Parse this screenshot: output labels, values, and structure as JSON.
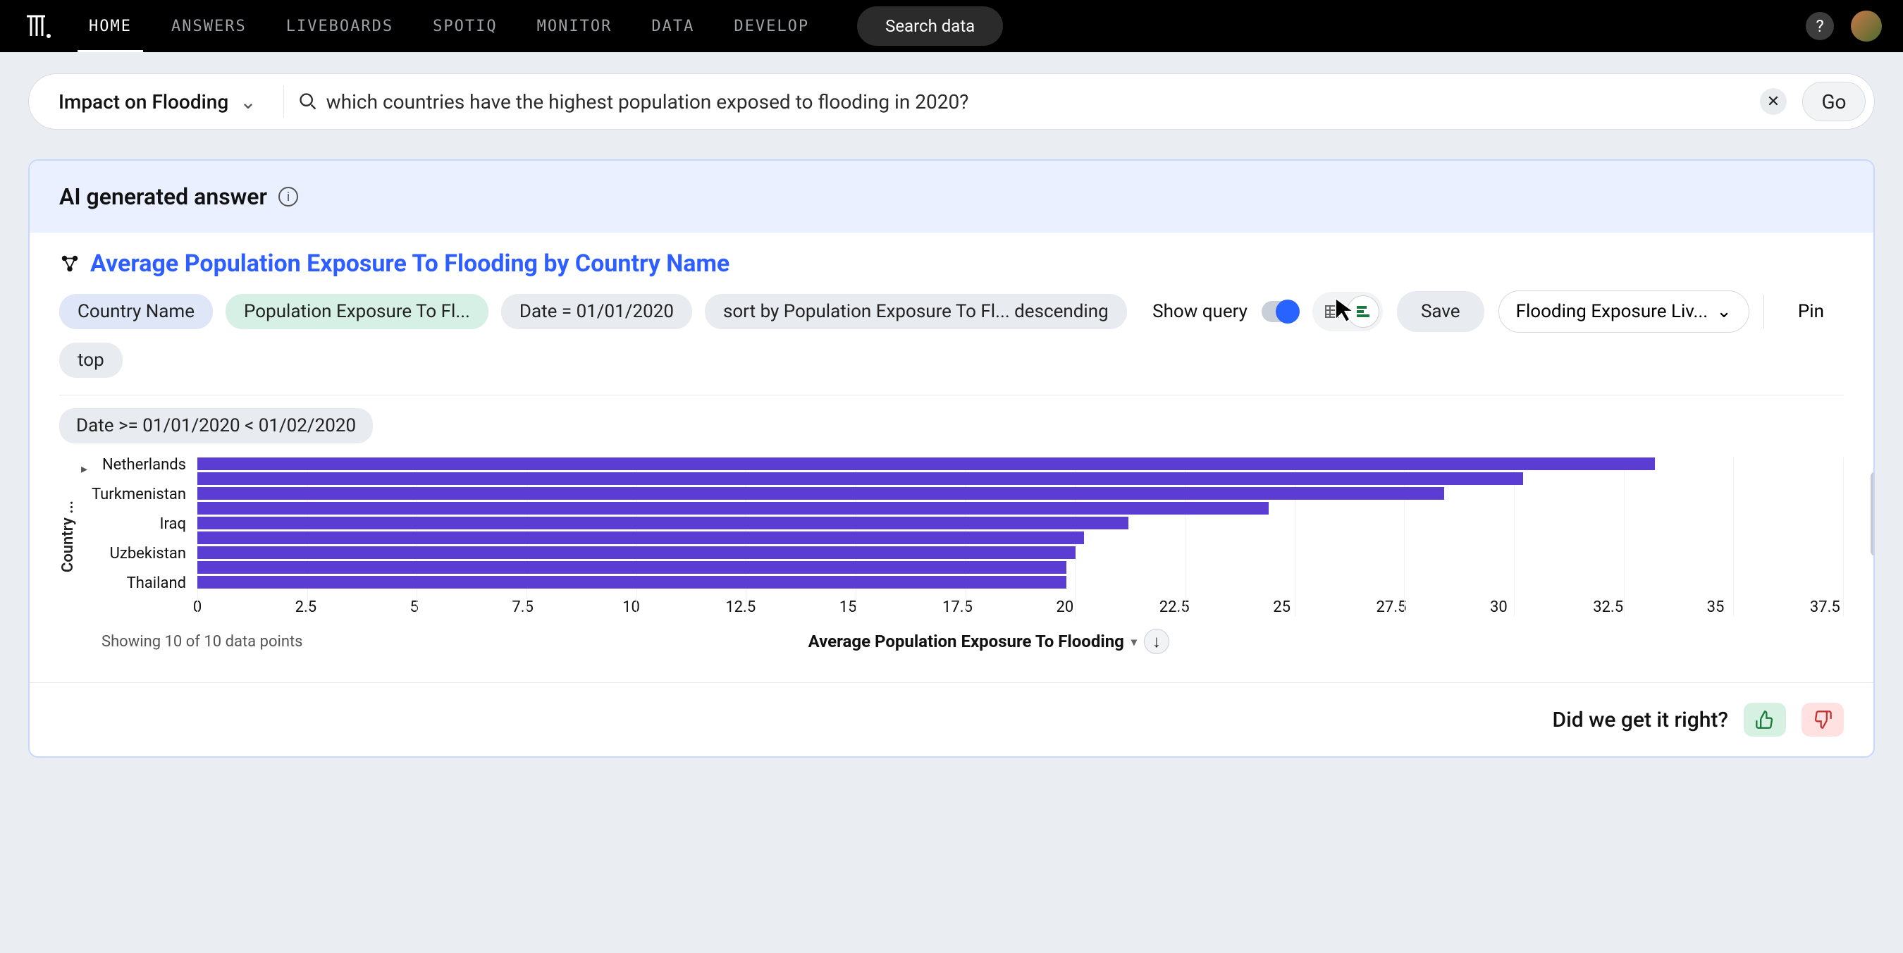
{
  "nav": {
    "items": [
      "HOME",
      "ANSWERS",
      "LIVEBOARDS",
      "SPOTIQ",
      "MONITOR",
      "DATA",
      "DEVELOP"
    ],
    "active_index": 0,
    "search_placeholder": "Search data"
  },
  "search": {
    "worksheet": "Impact on Flooding",
    "query": "which countries have the highest population exposed to flooding in 2020?",
    "go_label": "Go"
  },
  "answer": {
    "header": "AI generated answer",
    "title": "Average Population Exposure To Flooding by Country Name",
    "query_pills": [
      {
        "label": "Country Name",
        "variant": "attr-blue"
      },
      {
        "label": "Population Exposure To Fl...",
        "variant": "attr-green"
      },
      {
        "label": "Date = 01/01/2020",
        "variant": ""
      },
      {
        "label": "sort by Population Exposure To Fl...   descending",
        "variant": ""
      },
      {
        "label": "top",
        "variant": ""
      }
    ],
    "show_query_label": "Show query",
    "save_label": "Save",
    "destination_label": "Flooding Exposure Liv...",
    "pin_label": "Pin",
    "filter_chip": "Date >= 01/01/2020 < 01/02/2020",
    "footer_count": "Showing 10 of 10 data points",
    "xlabel": "Average Population Exposure To Flooding",
    "yaxis_title": "Country ...",
    "feedback_prompt": "Did we get it right?"
  },
  "chart_data": {
    "type": "bar",
    "orientation": "horizontal",
    "title": "Average Population Exposure To Flooding by Country Name",
    "xlabel": "Average Population Exposure To Flooding",
    "ylabel": "Country Name",
    "xlim": [
      0,
      37.5
    ],
    "xticks": [
      0,
      2.5,
      5,
      7.5,
      10,
      12.5,
      15,
      17.5,
      20,
      22.5,
      25,
      27.5,
      30,
      32.5,
      35,
      37.5
    ],
    "categories": [
      "Netherlands",
      "",
      "Turkmenistan",
      "",
      "Iraq",
      "",
      "Uzbekistan",
      "",
      "Thailand"
    ],
    "values": [
      33.2,
      30.2,
      28.4,
      24.4,
      21.2,
      20.2,
      20.0,
      19.8,
      19.8
    ],
    "color": "#5b3dd3",
    "data_points_shown": 10,
    "data_points_total": 10
  }
}
